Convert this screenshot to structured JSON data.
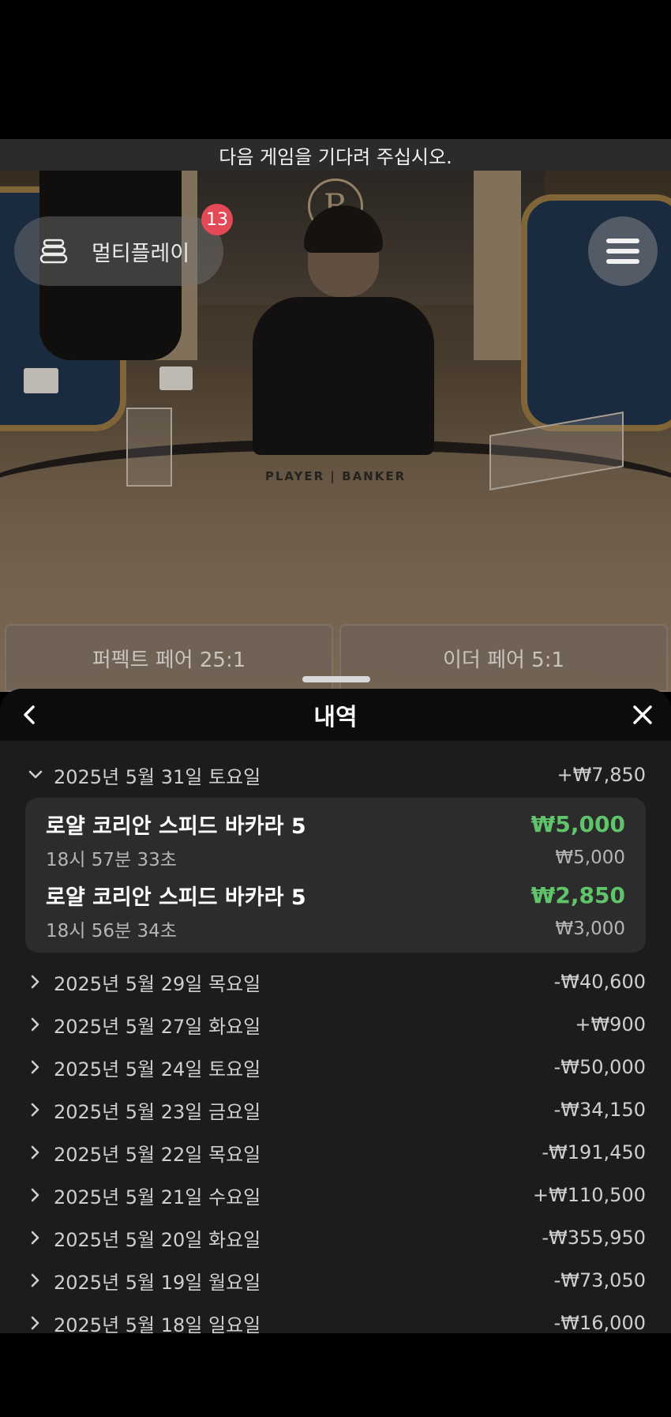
{
  "banner": {
    "text": "다음 게임을 기다려 주십시오."
  },
  "video": {
    "table_print": "PLAYER | BANKER",
    "crest_letter": "R"
  },
  "multiplay": {
    "label": "멀티플레이",
    "badge_count": "13"
  },
  "side_bets": [
    {
      "label": "퍼펙트 페어 25:1"
    },
    {
      "label": "이더 페어 5:1"
    }
  ],
  "history": {
    "title": "내역",
    "expanded_day": {
      "date": "2025년 5월 31일 토요일",
      "amount": "+₩7,850",
      "transactions": [
        {
          "name": "로얄 코리안 스피드 바카라 5",
          "win": "₩5,000",
          "time": "18시 57분 33초",
          "bet": "₩5,000"
        },
        {
          "name": "로얄 코리안 스피드 바카라 5",
          "win": "₩2,850",
          "time": "18시 56분 34초",
          "bet": "₩3,000"
        }
      ]
    },
    "days": [
      {
        "date": "2025년 5월 29일 목요일",
        "amount": "-₩40,600"
      },
      {
        "date": "2025년 5월 27일 화요일",
        "amount": "+₩900"
      },
      {
        "date": "2025년 5월 24일 토요일",
        "amount": "-₩50,000"
      },
      {
        "date": "2025년 5월 23일 금요일",
        "amount": "-₩34,150"
      },
      {
        "date": "2025년 5월 22일 목요일",
        "amount": "-₩191,450"
      },
      {
        "date": "2025년 5월 21일 수요일",
        "amount": "+₩110,500"
      },
      {
        "date": "2025년 5월 20일 화요일",
        "amount": "-₩355,950"
      },
      {
        "date": "2025년 5월 19일 월요일",
        "amount": "-₩73,050"
      },
      {
        "date": "2025년 5월 18일 일요일",
        "amount": "-₩16,000"
      }
    ]
  }
}
